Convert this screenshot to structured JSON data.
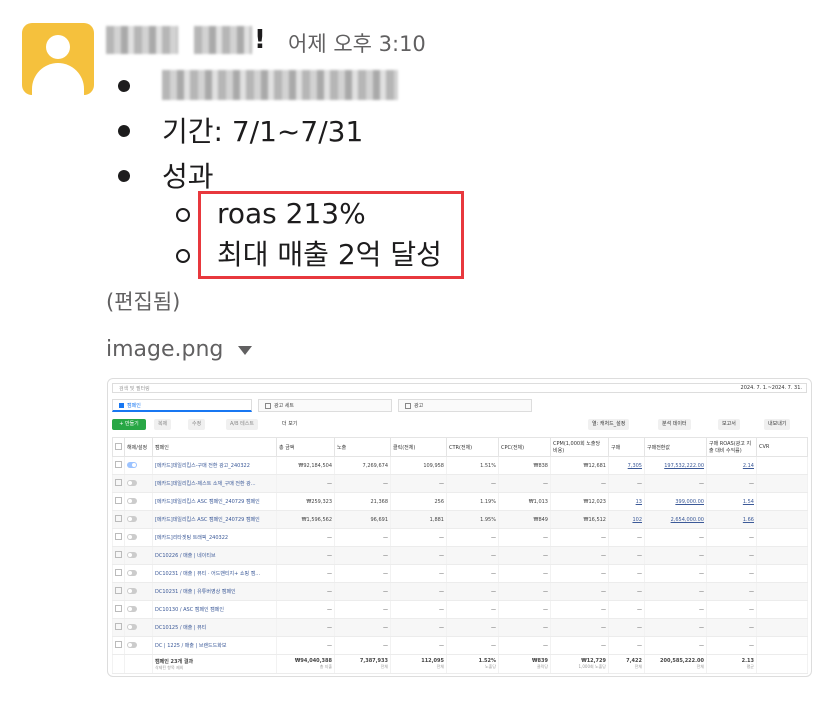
{
  "message": {
    "timestamp": "어제 오후 3:10",
    "bullets": [
      {
        "text": "기간: 7/1~7/31"
      },
      {
        "text": "성과"
      }
    ],
    "sub_bullets": [
      "roas 213%",
      "최대 매출 2억 달성"
    ],
    "edited_label": "(편집됨)",
    "attachment": {
      "name": "image.png"
    }
  },
  "screenshot": {
    "search_placeholder": "검색 및 필터링",
    "date_range": "2024. 7. 1.~2024. 7. 31.",
    "tabs": [
      "캠페인",
      "광고 세트",
      "광고"
    ],
    "toolbar": {
      "create": "+ 만들기",
      "duplicate": "복제",
      "edit": "수정",
      "ab_test": "A/B 테스트",
      "more": "더 보기",
      "columns": "열: 캐처드_설정",
      "breakdown": "분석 데이터",
      "reports": "보고서",
      "export": "내보내기"
    },
    "columns": [
      "해제/설정",
      "캠페인",
      "총 금액",
      "노출",
      "클릭(전체)",
      "CTR(전체)",
      "CPC(전체)",
      "CPM(1,000회 노출당 비용)",
      "구매",
      "구매전환값",
      "구매 ROAS(광고 지출 대비 수익률)",
      "CVR"
    ],
    "rows": [
      {
        "name": "[메카드]데일리킵스-구매 전환 광고_240322",
        "on": true,
        "cells": [
          "₩92,184,504",
          "7,269,674",
          "109,958",
          "1.51%",
          "₩838",
          "₩12,681",
          "7,305",
          "197,532,222.00",
          "2.14",
          ""
        ]
      },
      {
        "name": "[메카드]데일리킵스-제스트 소재_구매 전환 광...",
        "on": false,
        "cells": [
          "—",
          "—",
          "—",
          "—",
          "—",
          "—",
          "—",
          "—",
          "—",
          ""
        ]
      },
      {
        "name": "[메카드]데일리킵스 ASC 캠페인_240729 캠페인",
        "on": false,
        "cells": [
          "₩259,323",
          "21,368",
          "256",
          "1.19%",
          "₩1,013",
          "₩12,023",
          "13",
          "399,000.00",
          "1.54",
          ""
        ]
      },
      {
        "name": "[메카드]데일리킵스 ASC 캠페인_240729 캠페인",
        "on": false,
        "cells": [
          "₩1,596,562",
          "96,691",
          "1,881",
          "1.95%",
          "₩849",
          "₩16,512",
          "102",
          "2,654,000.00",
          "1.66",
          ""
        ]
      },
      {
        "name": "[메카드]리타겟팅 트래픽_240322",
        "on": false,
        "cells": [
          "—",
          "—",
          "—",
          "—",
          "—",
          "—",
          "—",
          "—",
          "—",
          ""
        ]
      },
      {
        "name": "DC10226 / 매출 | 네이티브",
        "on": false,
        "cells": [
          "—",
          "—",
          "—",
          "—",
          "—",
          "—",
          "—",
          "—",
          "—",
          ""
        ]
      },
      {
        "name": "DC10231 / 매출 | 뷰티 · 어드밴티지+ 쇼핑 캠...",
        "on": false,
        "cells": [
          "—",
          "—",
          "—",
          "—",
          "—",
          "—",
          "—",
          "—",
          "—",
          ""
        ]
      },
      {
        "name": "DC10231 / 매출 | 유튜버영상 캠페인",
        "on": false,
        "cells": [
          "—",
          "—",
          "—",
          "—",
          "—",
          "—",
          "—",
          "—",
          "—",
          ""
        ]
      },
      {
        "name": "DC10130 / ASC 캠페인 캠페인",
        "on": false,
        "cells": [
          "—",
          "—",
          "—",
          "—",
          "—",
          "—",
          "—",
          "—",
          "—",
          ""
        ]
      },
      {
        "name": "DC10125 / 매출 | 뷰티",
        "on": false,
        "cells": [
          "—",
          "—",
          "—",
          "—",
          "—",
          "—",
          "—",
          "—",
          "—",
          ""
        ]
      },
      {
        "name": "DC | 1225 / 매출 | 브랜드드화보",
        "on": false,
        "cells": [
          "—",
          "—",
          "—",
          "—",
          "—",
          "—",
          "—",
          "—",
          "—",
          ""
        ]
      }
    ],
    "total": {
      "label": "캠페인 23개 결과",
      "sublabel": "삭제된 항목 제외",
      "cells": [
        "₩94,040,388",
        "7,387,933",
        "112,095",
        "1.52%",
        "₩839",
        "₩12,729",
        "7,422",
        "200,585,222.00",
        "2.13",
        ""
      ],
      "subs": [
        "총 지출",
        "전체",
        "전체",
        "노출당",
        "클릭당",
        "1,000회 노출당",
        "전체",
        "전체",
        "평균",
        ""
      ]
    }
  }
}
